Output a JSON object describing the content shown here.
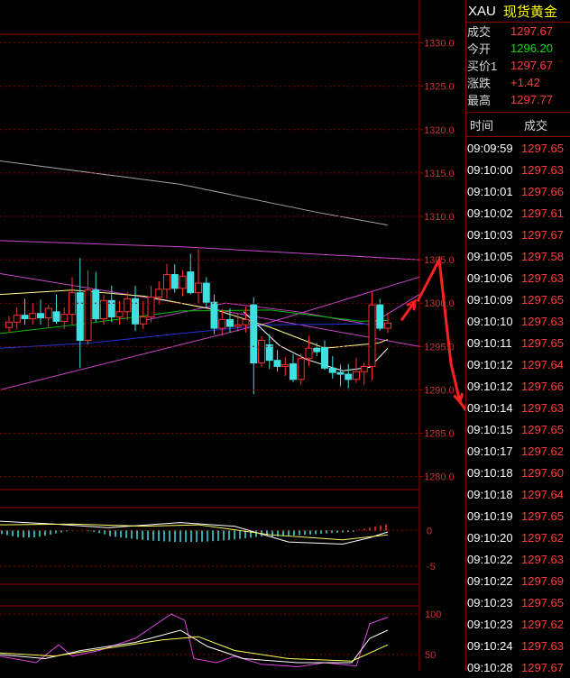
{
  "chart_data": [
    {
      "type": "candlestick",
      "y_axis_ticks": [
        "1330.0",
        "1325.0",
        "1320.0",
        "1315.0",
        "1310.0",
        "1305.0",
        "1300.0",
        "1295.0",
        "1290.0",
        "1285.0",
        "1280.0"
      ],
      "ylim": [
        1278.5,
        1331
      ],
      "candles": [
        {
          "o": 1297.2,
          "h": 1298.5,
          "l": 1296.6,
          "c": 1297.8
        },
        {
          "o": 1297.8,
          "h": 1299.5,
          "l": 1297.0,
          "c": 1298.6
        },
        {
          "o": 1298.6,
          "h": 1300.5,
          "l": 1297.5,
          "c": 1298.2
        },
        {
          "o": 1298.2,
          "h": 1300.0,
          "l": 1297.5,
          "c": 1298.8
        },
        {
          "o": 1298.8,
          "h": 1300.4,
          "l": 1297.5,
          "c": 1298.3
        },
        {
          "o": 1298.3,
          "h": 1299.8,
          "l": 1297.2,
          "c": 1299.4
        },
        {
          "o": 1299.0,
          "h": 1301.0,
          "l": 1297.6,
          "c": 1297.9
        },
        {
          "o": 1297.9,
          "h": 1299.5,
          "l": 1297.0,
          "c": 1298.7
        },
        {
          "o": 1298.7,
          "h": 1303.0,
          "l": 1297.5,
          "c": 1301.2
        },
        {
          "o": 1301.2,
          "h": 1305.2,
          "l": 1292.5,
          "c": 1295.7
        },
        {
          "o": 1295.7,
          "h": 1303.8,
          "l": 1295.2,
          "c": 1301.5
        },
        {
          "o": 1301.5,
          "h": 1303.6,
          "l": 1297.8,
          "c": 1298.2
        },
        {
          "o": 1298.2,
          "h": 1301.0,
          "l": 1297.5,
          "c": 1300.3
        },
        {
          "o": 1300.3,
          "h": 1302.0,
          "l": 1297.8,
          "c": 1298.4
        },
        {
          "o": 1298.4,
          "h": 1300.2,
          "l": 1297.5,
          "c": 1299.0
        },
        {
          "o": 1299.0,
          "h": 1301.3,
          "l": 1298.0,
          "c": 1300.5
        },
        {
          "o": 1300.5,
          "h": 1302.0,
          "l": 1296.8,
          "c": 1297.6
        },
        {
          "o": 1297.6,
          "h": 1300.2,
          "l": 1297.0,
          "c": 1298.4
        },
        {
          "o": 1298.4,
          "h": 1302.0,
          "l": 1297.8,
          "c": 1300.7
        },
        {
          "o": 1300.7,
          "h": 1302.5,
          "l": 1299.8,
          "c": 1301.6
        },
        {
          "o": 1301.6,
          "h": 1304.5,
          "l": 1300.5,
          "c": 1303.3
        },
        {
          "o": 1303.3,
          "h": 1304.5,
          "l": 1301.2,
          "c": 1301.7
        },
        {
          "o": 1301.7,
          "h": 1303.8,
          "l": 1300.8,
          "c": 1303.1
        },
        {
          "o": 1303.6,
          "h": 1305.7,
          "l": 1301.0,
          "c": 1301.2
        },
        {
          "o": 1301.2,
          "h": 1306.2,
          "l": 1300.0,
          "c": 1302.3
        },
        {
          "o": 1302.3,
          "h": 1303.0,
          "l": 1299.5,
          "c": 1300.1
        },
        {
          "o": 1300.1,
          "h": 1301.0,
          "l": 1296.4,
          "c": 1297.1
        },
        {
          "o": 1297.1,
          "h": 1299.3,
          "l": 1296.2,
          "c": 1298.1
        },
        {
          "o": 1298.1,
          "h": 1299.4,
          "l": 1296.6,
          "c": 1297.3
        },
        {
          "o": 1297.3,
          "h": 1298.8,
          "l": 1296.7,
          "c": 1297.5
        },
        {
          "o": 1297.5,
          "h": 1299.6,
          "l": 1296.6,
          "c": 1298.1
        },
        {
          "o": 1299.8,
          "h": 1300.7,
          "l": 1289.5,
          "c": 1293.1
        },
        {
          "o": 1293.1,
          "h": 1296.2,
          "l": 1292.6,
          "c": 1295.7
        },
        {
          "o": 1295.2,
          "h": 1296.4,
          "l": 1292.4,
          "c": 1293.4
        },
        {
          "o": 1293.4,
          "h": 1294.6,
          "l": 1292.1,
          "c": 1292.7
        },
        {
          "o": 1292.7,
          "h": 1293.8,
          "l": 1291.6,
          "c": 1292.9
        },
        {
          "o": 1293.0,
          "h": 1294.1,
          "l": 1290.9,
          "c": 1291.2
        },
        {
          "o": 1291.2,
          "h": 1294.2,
          "l": 1290.6,
          "c": 1293.6
        },
        {
          "o": 1293.6,
          "h": 1296.2,
          "l": 1292.7,
          "c": 1294.8
        },
        {
          "o": 1294.8,
          "h": 1295.4,
          "l": 1293.9,
          "c": 1294.4
        },
        {
          "o": 1294.9,
          "h": 1295.7,
          "l": 1292.3,
          "c": 1292.5
        },
        {
          "o": 1292.5,
          "h": 1293.9,
          "l": 1291.3,
          "c": 1292.0
        },
        {
          "o": 1292.0,
          "h": 1292.9,
          "l": 1290.4,
          "c": 1291.8
        },
        {
          "o": 1291.8,
          "h": 1293.0,
          "l": 1290.2,
          "c": 1291.2
        },
        {
          "o": 1291.2,
          "h": 1293.7,
          "l": 1290.8,
          "c": 1292.1
        },
        {
          "o": 1292.1,
          "h": 1293.1,
          "l": 1290.6,
          "c": 1292.7
        },
        {
          "o": 1292.7,
          "h": 1301.3,
          "l": 1291.1,
          "c": 1299.8
        },
        {
          "o": 1299.8,
          "h": 1300.5,
          "l": 1296.8,
          "c": 1297.1
        },
        {
          "o": 1297.1,
          "h": 1298.9,
          "l": 1296.6,
          "c": 1297.7
        }
      ],
      "lines": [
        {
          "color": "#a0a0a0",
          "points": [
            [
              0,
              1316.4
            ],
            [
              200,
              1313.7
            ],
            [
              350,
              1310.5
            ],
            [
              430,
              1309.0
            ]
          ]
        },
        {
          "color": "#cc44cc",
          "points": [
            [
              0,
              1307.2
            ],
            [
              200,
              1306.5
            ],
            [
              465,
              1305.0
            ]
          ]
        },
        {
          "color": "#cc44cc",
          "points": [
            [
              0,
              1290.0
            ],
            [
              300,
              1297.8
            ],
            [
              465,
              1303.0
            ]
          ]
        },
        {
          "color": "#cc44cc",
          "points": [
            [
              0,
              1303.4
            ],
            [
              200,
              1300.0
            ],
            [
              465,
              1295.0
            ]
          ]
        },
        {
          "color": "#cc44cc",
          "points": [
            [
              160,
              1298.0
            ],
            [
              250,
              1300.0
            ],
            [
              330,
              1299.0
            ],
            [
              410,
              1297.5
            ],
            [
              465,
              1301.0
            ]
          ]
        },
        {
          "color": "#2233dd",
          "points": [
            [
              0,
              1294.8
            ],
            [
              100,
              1295.4
            ],
            [
              200,
              1296.5
            ],
            [
              300,
              1297.5
            ],
            [
              400,
              1297.6
            ],
            [
              430,
              1297.5
            ]
          ]
        },
        {
          "color": "#ffff88",
          "points": [
            [
              0,
              1301.0
            ],
            [
              80,
              1301.5
            ],
            [
              160,
              1300.8
            ],
            [
              240,
              1299.2
            ],
            [
              300,
              1297.2
            ],
            [
              360,
              1294.8
            ],
            [
              420,
              1295.4
            ],
            [
              430,
              1295.8
            ]
          ]
        },
        {
          "color": "#00c000",
          "points": [
            [
              0,
              1296.5
            ],
            [
              100,
              1297.7
            ],
            [
              200,
              1299.1
            ],
            [
              300,
              1299.2
            ],
            [
              400,
              1297.9
            ],
            [
              430,
              1298.0
            ]
          ]
        },
        {
          "color": "#ffffff",
          "points": [
            [
              270,
              1299.0
            ],
            [
              310,
              1295.1
            ],
            [
              340,
              1293.5
            ],
            [
              380,
              1292.2
            ],
            [
              410,
              1292.6
            ],
            [
              430,
              1294.8
            ]
          ]
        }
      ],
      "arrows": [
        {
          "color": "#ff2020",
          "points": [
            [
              445,
              1298.0
            ],
            [
              460,
              1300.2
            ]
          ]
        },
        {
          "color": "#ff2020",
          "points": [
            [
              463,
              1300.2
            ],
            [
              487,
              1305.0
            ],
            [
              500,
              1293.0
            ],
            [
              510,
              1288.6
            ]
          ]
        },
        {
          "color": "#ff2020",
          "points": [
            [
              510,
              1288.6
            ],
            [
              565,
              1280.8
            ]
          ]
        }
      ]
    },
    {
      "type": "bar+line",
      "y_axis_ticks": [
        "0",
        "-5"
      ],
      "ylim": [
        -7.5,
        3.2
      ]
    },
    {
      "type": "line",
      "y_axis_ticks": [
        "100",
        "50"
      ],
      "ylim": [
        30,
        110
      ]
    }
  ],
  "quote": {
    "symbol": "XAU",
    "name": "现货黄金",
    "rows": [
      {
        "label": "成交",
        "value": "1297.67",
        "color": "red"
      },
      {
        "label": "今开",
        "value": "1296.20",
        "color": "green"
      },
      {
        "label": "买价1",
        "value": "1297.67",
        "color": "red"
      },
      {
        "label": "涨跌",
        "value": "+1.42",
        "color": "red"
      },
      {
        "label": "最高",
        "value": "1297.77",
        "color": "red"
      }
    ],
    "col_time": "时间",
    "col_price": "成交",
    "ticks": [
      [
        "09:09:59",
        "1297.65"
      ],
      [
        "09:10:00",
        "1297.63"
      ],
      [
        "09:10:01",
        "1297.66"
      ],
      [
        "09:10:02",
        "1297.61"
      ],
      [
        "09:10:03",
        "1297.67"
      ],
      [
        "09:10:05",
        "1297.58"
      ],
      [
        "09:10:06",
        "1297.63"
      ],
      [
        "09:10:09",
        "1297.65"
      ],
      [
        "09:10:10",
        "1297.63"
      ],
      [
        "09:10:11",
        "1297.65"
      ],
      [
        "09:10:12",
        "1297.64"
      ],
      [
        "09:10:12",
        "1297.66"
      ],
      [
        "09:10:14",
        "1297.63"
      ],
      [
        "09:10:15",
        "1297.65"
      ],
      [
        "09:10:17",
        "1297.62"
      ],
      [
        "09:10:18",
        "1297.60"
      ],
      [
        "09:10:18",
        "1297.64"
      ],
      [
        "09:10:19",
        "1297.65"
      ],
      [
        "09:10:20",
        "1297.62"
      ],
      [
        "09:10:22",
        "1297.63"
      ],
      [
        "09:10:22",
        "1297.69"
      ],
      [
        "09:10:23",
        "1297.65"
      ],
      [
        "09:10:23",
        "1297.62"
      ],
      [
        "09:10:24",
        "1297.63"
      ],
      [
        "09:10:28",
        "1297.67"
      ]
    ]
  }
}
